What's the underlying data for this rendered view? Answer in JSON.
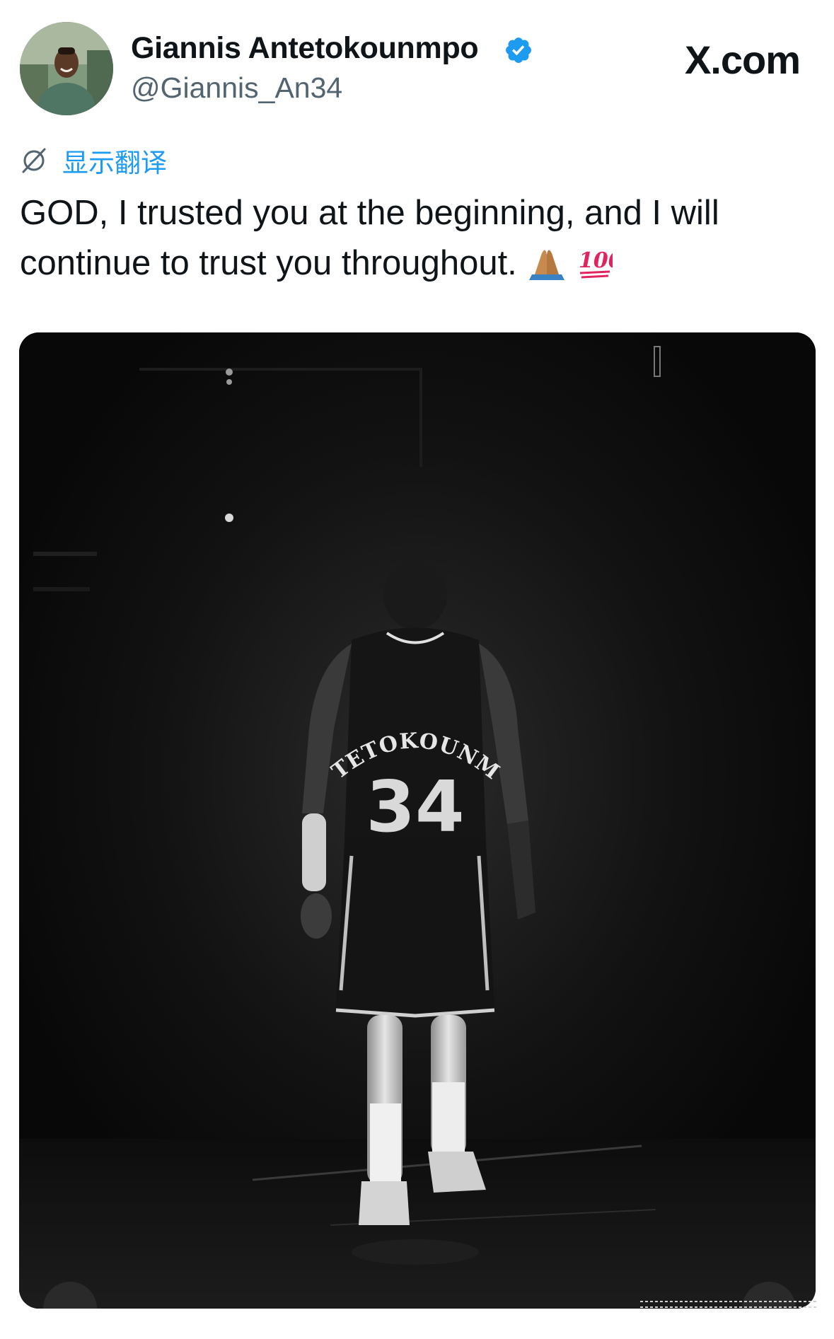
{
  "author": {
    "display_name": "Giannis Antetokounmpo",
    "handle": "@Giannis_An34",
    "verified": true
  },
  "brand": {
    "label": "X.com"
  },
  "translate": {
    "label": "显示翻译"
  },
  "tweet": {
    "line1": "GOD, I trusted you at the beginning, and I will",
    "line2": "continue to trust you throughout."
  },
  "media": {
    "jersey_name": "ANTETOKOUNMPO",
    "jersey_number": "34"
  },
  "colors": {
    "accent": "#1d9bf0",
    "text": "#0f1419",
    "secondary": "#536471",
    "media_bg": "#0a0a0a"
  },
  "icons": [
    "verified-badge-icon",
    "translate-globe-icon",
    "praying-hands-emoji",
    "hundred-points-emoji"
  ]
}
